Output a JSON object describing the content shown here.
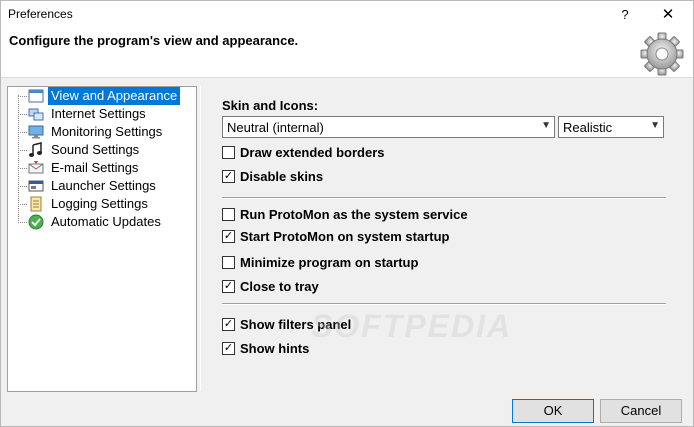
{
  "window": {
    "title": "Preferences",
    "help_label": "?",
    "close_label": "✕"
  },
  "header": {
    "text": "Configure the program's view and appearance.",
    "icon": "gear-icon"
  },
  "tree": {
    "items": [
      {
        "label": "View and Appearance",
        "icon": "window-icon",
        "selected": true
      },
      {
        "label": "Internet Settings",
        "icon": "network-icon",
        "selected": false
      },
      {
        "label": "Monitoring Settings",
        "icon": "monitor-icon",
        "selected": false
      },
      {
        "label": "Sound Settings",
        "icon": "music-note-icon",
        "selected": false
      },
      {
        "label": "E-mail Settings",
        "icon": "envelope-icon",
        "selected": false
      },
      {
        "label": "Launcher Settings",
        "icon": "launcher-icon",
        "selected": false
      },
      {
        "label": "Logging Settings",
        "icon": "log-icon",
        "selected": false
      },
      {
        "label": "Automatic Updates",
        "icon": "globe-update-icon",
        "selected": false
      }
    ]
  },
  "panel": {
    "skin_label": "Skin and Icons:",
    "skin_value": "Neutral (internal)",
    "icons_value": "Realistic",
    "checks": [
      {
        "label": "Draw extended borders",
        "checked": false
      },
      {
        "label": "Disable skins",
        "checked": true
      },
      {
        "label": "Run ProtoMon as the system service",
        "checked": false
      },
      {
        "label": "Start ProtoMon on system startup",
        "checked": true
      },
      {
        "label": "Minimize program on startup",
        "checked": false
      },
      {
        "label": "Close to tray",
        "checked": true
      },
      {
        "label": "Show filters panel",
        "checked": true
      },
      {
        "label": "Show hints",
        "checked": true
      }
    ]
  },
  "buttons": {
    "ok": "OK",
    "cancel": "Cancel"
  },
  "watermark": "SOFTPEDIA",
  "colors": {
    "selection": "#0078d7",
    "background": "#f0f0f0"
  }
}
